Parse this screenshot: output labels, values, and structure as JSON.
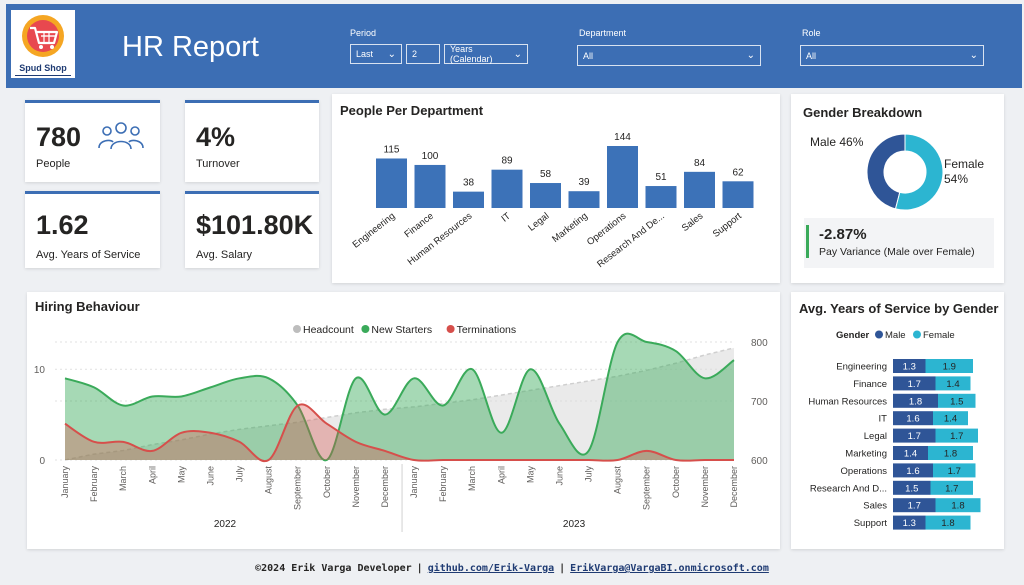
{
  "header": {
    "logo_text": "Spud Shop",
    "title": "HR Report",
    "filters": {
      "period_label": "Period",
      "period_mode": "Last",
      "period_count": "2",
      "period_unit": "Years (Calendar)",
      "department_label": "Department",
      "department_value": "All",
      "role_label": "Role",
      "role_value": "All"
    }
  },
  "kpis": {
    "people_value": "780",
    "people_label": "People",
    "turnover_value": "4%",
    "turnover_label": "Turnover",
    "service_value": "1.62",
    "service_label": "Avg. Years of Service",
    "salary_value": "$101.80K",
    "salary_label": "Avg. Salary"
  },
  "gender": {
    "title": "Gender Breakdown",
    "male_label": "Male",
    "male_pct": "46%",
    "female_label": "Female",
    "female_pct": "54%",
    "variance_value": "-2.87%",
    "variance_label": "Pay Variance (Male over Female)"
  },
  "hiring": {
    "title": "Hiring Behaviour"
  },
  "service_by_gender": {
    "title": "Avg. Years of Service by Gender"
  },
  "footer": {
    "copyright": "©2024 Erik Varga Developer",
    "link": "github.com/Erik-Varga",
    "email": "ErikVarga@VargaBI.onmicrosoft.com"
  },
  "colors": {
    "accent": "#3c6eb4",
    "bar": "#3c72b8",
    "male": "#2f5597",
    "female": "#2cb5d1",
    "green": "#3aaa5a",
    "red": "#d64f4b",
    "gray": "#d9d9d9"
  },
  "chart_data": [
    {
      "type": "bar",
      "title": "People Per Department",
      "categories": [
        "Engineering",
        "Finance",
        "Human Resources",
        "IT",
        "Legal",
        "Marketing",
        "Operations",
        "Research And De...",
        "Sales",
        "Support"
      ],
      "values": [
        115,
        100,
        38,
        89,
        58,
        39,
        144,
        51,
        84,
        62
      ]
    },
    {
      "type": "pie",
      "title": "Gender Breakdown",
      "categories": [
        "Male",
        "Female"
      ],
      "values": [
        46,
        54
      ]
    },
    {
      "type": "bar",
      "title": "Avg. Years of Service by Gender",
      "legend_title": "Gender",
      "categories": [
        "Engineering",
        "Finance",
        "Human Resources",
        "IT",
        "Legal",
        "Marketing",
        "Operations",
        "Research And D...",
        "Sales",
        "Support"
      ],
      "series": [
        {
          "name": "Male",
          "values": [
            1.3,
            1.7,
            1.8,
            1.6,
            1.7,
            1.4,
            1.6,
            1.5,
            1.7,
            1.3
          ]
        },
        {
          "name": "Female",
          "values": [
            1.9,
            1.4,
            1.5,
            1.4,
            1.7,
            1.8,
            1.7,
            1.7,
            1.8,
            1.8
          ]
        }
      ]
    },
    {
      "type": "area",
      "title": "Hiring Behaviour",
      "x": [
        "January",
        "February",
        "March",
        "April",
        "May",
        "June",
        "July",
        "August",
        "September",
        "October",
        "November",
        "December",
        "January",
        "February",
        "March",
        "April",
        "May",
        "June",
        "July",
        "August",
        "September",
        "October",
        "November",
        "December"
      ],
      "x_groups": [
        {
          "label": "2022",
          "span": 12
        },
        {
          "label": "2023",
          "span": 12
        }
      ],
      "legend_position": "top",
      "y_left_ticks": [
        0,
        10
      ],
      "y_left_range": [
        0,
        13
      ],
      "y_right_ticks": [
        600,
        700,
        800
      ],
      "y_right_range": [
        600,
        800
      ],
      "series": [
        {
          "name": "Headcount",
          "axis": "right",
          "values": [
            600,
            610,
            616,
            626,
            634,
            644,
            652,
            658,
            664,
            672,
            680,
            686,
            690,
            696,
            702,
            710,
            718,
            726,
            734,
            742,
            752,
            764,
            778,
            790
          ]
        },
        {
          "name": "New Starters",
          "axis": "left",
          "values": [
            9,
            8,
            6,
            7,
            7,
            8,
            9,
            9,
            6,
            0,
            9,
            5,
            9,
            6,
            10,
            3,
            10,
            4,
            1,
            13,
            13,
            12,
            9,
            11
          ]
        },
        {
          "name": "Terminations",
          "axis": "left",
          "values": [
            4,
            2,
            2,
            1,
            3,
            3,
            2,
            0,
            6,
            4,
            2,
            1,
            0,
            0,
            0,
            0,
            0,
            0,
            0,
            0,
            1,
            0,
            0,
            0
          ]
        }
      ]
    }
  ]
}
